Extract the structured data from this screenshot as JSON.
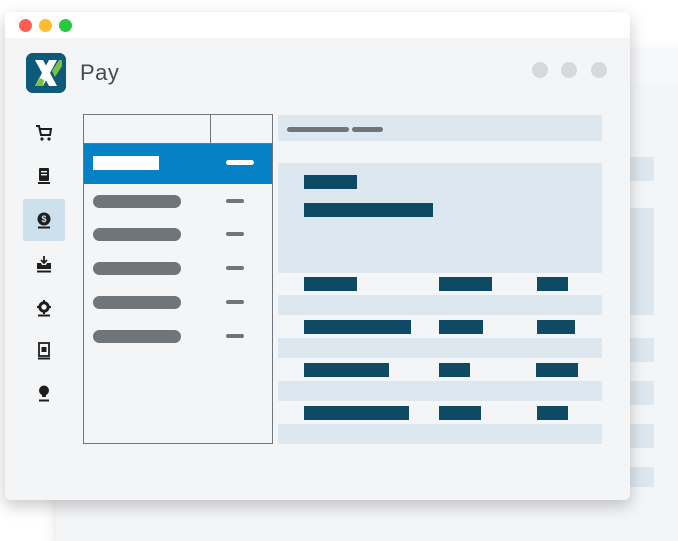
{
  "app": {
    "title": "Pay",
    "logo_letter": "X",
    "accent_color": "#0781c6",
    "brand_dark": "#0e4a64"
  },
  "window_controls": [
    "traffic-close",
    "traffic-minimize",
    "traffic-zoom"
  ],
  "sidebar": {
    "items": [
      {
        "icon": "cart-icon",
        "active": false
      },
      {
        "icon": "receipt-icon",
        "active": false
      },
      {
        "icon": "dollar-coin-icon",
        "active": true
      },
      {
        "icon": "inbox-icon",
        "active": false
      },
      {
        "icon": "settings-gear-icon",
        "active": false
      },
      {
        "icon": "document-icon",
        "active": false
      },
      {
        "icon": "lightbulb-icon",
        "active": false
      }
    ]
  },
  "list": {
    "rows": [
      {
        "selected": true
      },
      {
        "selected": false
      },
      {
        "selected": false
      },
      {
        "selected": false
      },
      {
        "selected": false
      },
      {
        "selected": false
      }
    ]
  }
}
